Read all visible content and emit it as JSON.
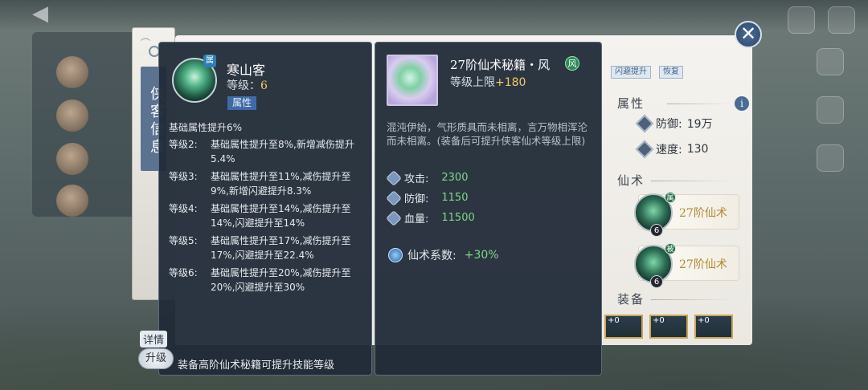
{
  "background": {
    "back_title": "",
    "ribbon_label": "侠客信息",
    "tags": [
      "闪避提升",
      "恢复"
    ],
    "attr_section": "属性",
    "stats": [
      {
        "label": "防御:",
        "value": "19万"
      },
      {
        "label": "速度:",
        "value": "130"
      }
    ],
    "skill_section": "仙术",
    "skills": [
      {
        "name": "27阶仙术",
        "badge": "属",
        "level": "6"
      },
      {
        "name": "27阶仙术",
        "badge": "被",
        "level": "6"
      }
    ],
    "equip_section": "装备",
    "equip_labels": [
      "+0",
      "+0",
      "+0"
    ],
    "info_icon": "i",
    "close_icon": "✕"
  },
  "skill_panel": {
    "icon_badge": "属",
    "title": "寒山客",
    "level_label": "等级：",
    "level_value": "6",
    "type_tag": "属性",
    "base_text": "基础属性提升6%",
    "levels": [
      {
        "k": "等级2:",
        "v": "基础属性提升至8%,新增减伤提升5.4%"
      },
      {
        "k": "等级3:",
        "v": "基础属性提升至11%,减伤提升至9%,新增闪避提升8.3%"
      },
      {
        "k": "等级4:",
        "v": "基础属性提升至14%,减伤提升至14%,闪避提升至14%"
      },
      {
        "k": "等级5:",
        "v": "基础属性提升至17%,减伤提升至17%,闪避提升至22.4%"
      },
      {
        "k": "等级6:",
        "v": "基础属性提升至20%,减伤提升至20%,闪避提升至30%"
      }
    ],
    "detail_label": "详情",
    "upgrade_label": "升级",
    "footer_note": "装备高阶仙术秘籍可提升技能等级"
  },
  "book_panel": {
    "title": "27阶仙术秘籍・风",
    "title_icon": "风",
    "cap_label": "等级上限",
    "cap_value": "+180",
    "description": "混沌伊始，气形质具而未相离，言万物相浑沦而未相离。(装备后可提升侠客仙术等级上限)",
    "stats": [
      {
        "label": "攻击:",
        "value": "2300"
      },
      {
        "label": "防御:",
        "value": "1150"
      },
      {
        "label": "血量:",
        "value": "11500"
      }
    ],
    "coef_label": "仙术系数:",
    "coef_value": "+30%"
  },
  "colors": {
    "panel_bg": "#212b38",
    "gold": "#f1cb6c",
    "green": "#7ed78b",
    "tag_blue": "#3e6aa8"
  }
}
